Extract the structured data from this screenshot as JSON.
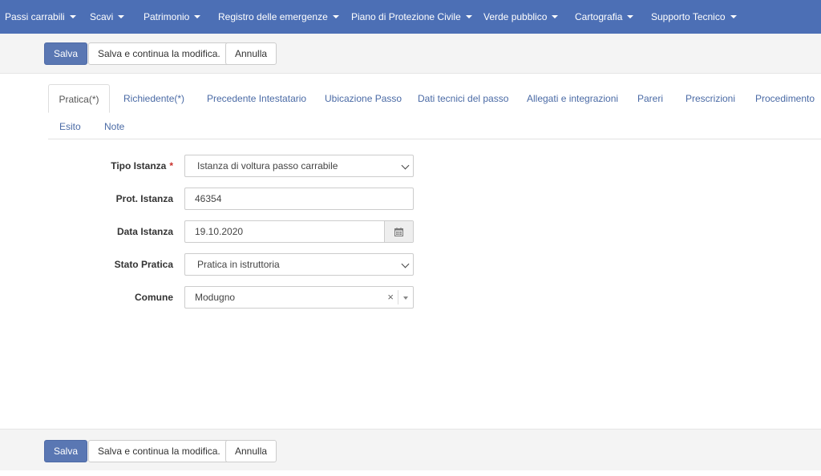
{
  "nav": {
    "items": [
      {
        "label": "Passi carrabili"
      },
      {
        "label": "Scavi"
      },
      {
        "label": "Patrimonio"
      },
      {
        "label": "Registro delle emergenze"
      },
      {
        "label": "Piano di Protezione Civile"
      },
      {
        "label": "Verde pubblico"
      },
      {
        "label": "Cartografia"
      },
      {
        "label": "Supporto Tecnico"
      }
    ]
  },
  "toolbar": {
    "save_label": "Salva",
    "save_continue_label": "Salva e continua la modifica.",
    "cancel_label": "Annulla"
  },
  "tabs": [
    {
      "label": "Pratica(*)",
      "active": true
    },
    {
      "label": "Richiedente(*)"
    },
    {
      "label": "Precedente Intestatario"
    },
    {
      "label": "Ubicazione Passo"
    },
    {
      "label": "Dati tecnici del passo"
    },
    {
      "label": "Allegati e integrazioni"
    },
    {
      "label": "Pareri"
    },
    {
      "label": "Prescrizioni"
    },
    {
      "label": "Procedimento"
    },
    {
      "label": "Esito"
    },
    {
      "label": "Note"
    }
  ],
  "form": {
    "tipo_istanza": {
      "label": "Tipo Istanza",
      "required_mark": "*",
      "value": "Istanza di voltura passo carrabile"
    },
    "prot_istanza": {
      "label": "Prot. Istanza",
      "value": "46354"
    },
    "data_istanza": {
      "label": "Data Istanza",
      "value": "19.10.2020"
    },
    "stato_pratica": {
      "label": "Stato Pratica",
      "value": "Pratica in istruttoria"
    },
    "comune": {
      "label": "Comune",
      "value": "Modugno",
      "clear_glyph": "×"
    }
  },
  "icons": {
    "caret": "caret-down-icon",
    "calendar": "calendar-icon",
    "chevron": "chevron-down-icon",
    "clear": "clear-icon"
  },
  "colors": {
    "nav_bg": "#4c6fb5",
    "primary_button": "#5a77b3",
    "tab_link": "#4a6aa5",
    "required": "#c9302c"
  }
}
